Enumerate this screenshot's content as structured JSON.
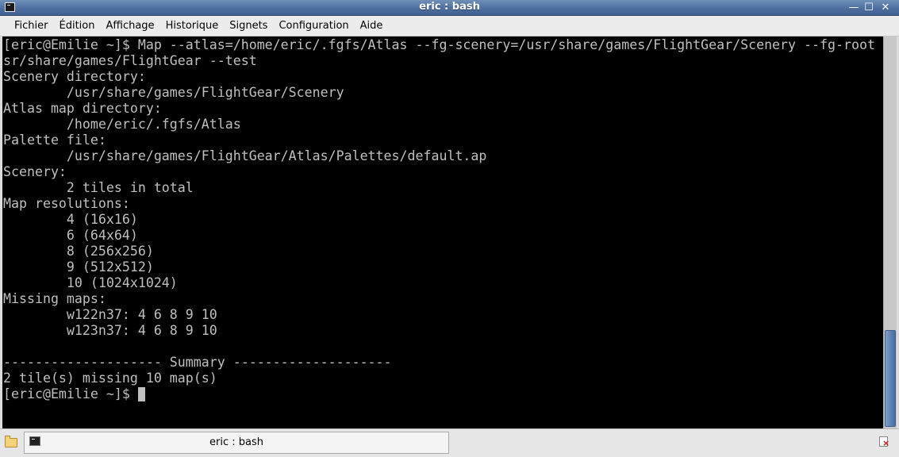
{
  "window": {
    "title": "eric : bash",
    "icon": "terminal-icon",
    "controls": {
      "minimize": "—",
      "maximize": "☐",
      "close": "✕"
    }
  },
  "menubar": {
    "items": [
      {
        "label": "Fichier"
      },
      {
        "label": "Édition"
      },
      {
        "label": "Affichage"
      },
      {
        "label": "Historique"
      },
      {
        "label": "Signets"
      },
      {
        "label": "Configuration"
      },
      {
        "label": "Aide"
      }
    ]
  },
  "terminal": {
    "lines": [
      "[eric@Emilie ~]$ Map --atlas=/home/eric/.fgfs/Atlas --fg-scenery=/usr/share/games/FlightGear/Scenery --fg-root",
      "sr/share/games/FlightGear --test",
      "Scenery directory:",
      "        /usr/share/games/FlightGear/Scenery",
      "Atlas map directory:",
      "        /home/eric/.fgfs/Atlas",
      "Palette file:",
      "        /usr/share/games/FlightGear/Atlas/Palettes/default.ap",
      "Scenery:",
      "        2 tiles in total",
      "Map resolutions:",
      "        4 (16x16)",
      "        6 (64x64)",
      "        8 (256x256)",
      "        9 (512x512)",
      "        10 (1024x1024)",
      "Missing maps:",
      "        w122n37: 4 6 8 9 10",
      "        w123n37: 4 6 8 9 10",
      "",
      "-------------------- Summary --------------------",
      "2 tile(s) missing 10 map(s)"
    ],
    "prompt": "[eric@Emilie ~]$ ",
    "colors": {
      "background": "#000000",
      "foreground": "#bfbfbf"
    }
  },
  "taskbar": {
    "launcher_icon": "folder-icon",
    "task": {
      "label": "eric : bash",
      "icon": "terminal-icon"
    },
    "tray_icon": "document-error-icon"
  }
}
